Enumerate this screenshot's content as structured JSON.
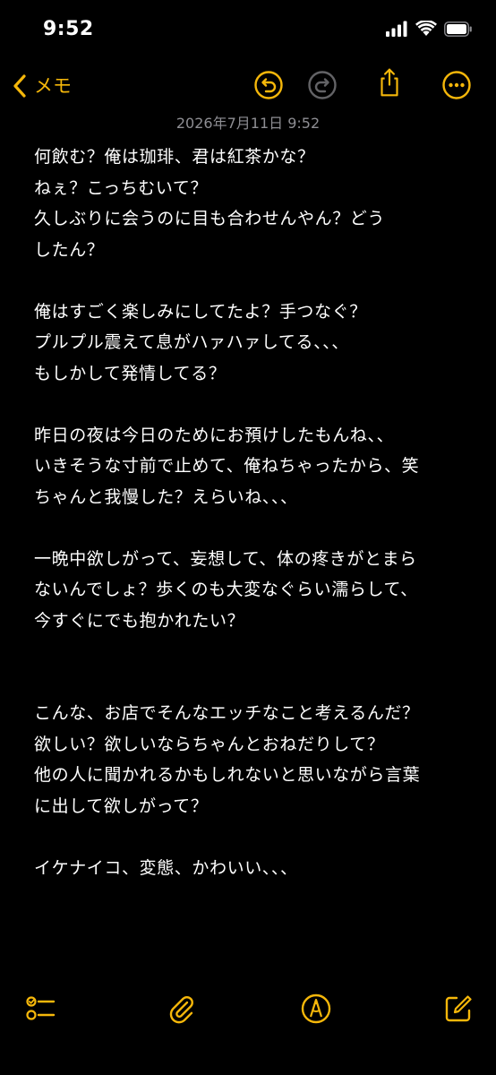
{
  "status_bar": {
    "time": "9:52"
  },
  "nav": {
    "back_label": "メモ",
    "icons": [
      "undo-icon",
      "redo-icon",
      "share-icon",
      "more-icon"
    ]
  },
  "note": {
    "timestamp": "2026年7月11日 9:52",
    "lines": [
      "何飲む？俺は珈琲、君は紅茶かな？",
      "ねぇ？こっちむいて？",
      "久しぶりに会うのに目も合わせんやん？どう",
      "したん？",
      "",
      "俺はすごく楽しみにしてたよ？手つなぐ？",
      "プルプル震えて息がハァハァしてる、、、",
      "もしかして発情してる？",
      "",
      "昨日の夜は今日のためにお預けしたもんね、、",
      "いきそうな寸前で止めて、俺ねちゃったから、笑",
      "ちゃんと我慢した？えらいね、、、",
      "",
      "一晩中欲しがって、妄想して、体の疼きがとまら",
      "ないんでしょ？歩くのも大変なぐらい濡らして、",
      "今すぐにでも抱かれたい？",
      "",
      "",
      "こんな、お店でそんなエッチなこと考えるんだ？",
      "欲しい？欲しいならちゃんとおねだりして？",
      "他の人に聞かれるかもしれないと思いながら言葉",
      "に出して欲しがって？",
      "",
      "イケナイコ、変態、かわいい、、、"
    ]
  },
  "toolbar": {
    "icons": [
      "checklist-icon",
      "attachment-icon",
      "markup-icon",
      "compose-icon"
    ]
  },
  "colors": {
    "accent": "#f5b70a",
    "disabled": "#636366",
    "timestamp": "#8e8e93",
    "background": "#000000",
    "text": "#ffffff"
  }
}
